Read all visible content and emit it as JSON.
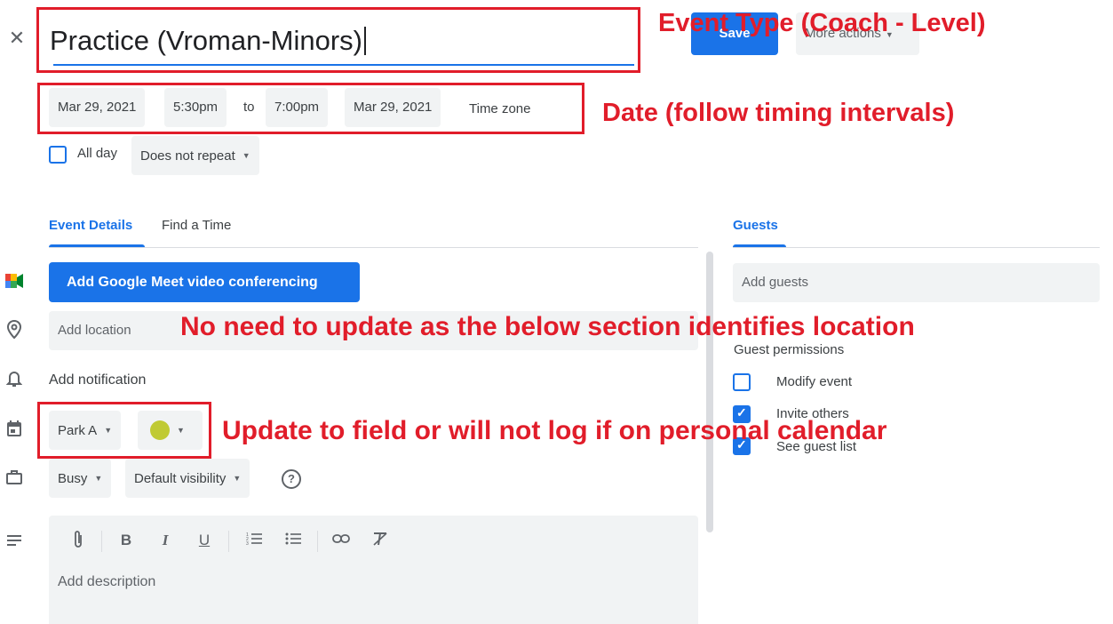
{
  "header": {
    "close_icon": "close-icon",
    "title": "Practice (Vroman-Minors)",
    "save_label": "Save",
    "more_actions_label": "More actions"
  },
  "datetime": {
    "start_date": "Mar 29, 2021",
    "start_time": "5:30pm",
    "to_label": "to",
    "end_time": "7:00pm",
    "end_date": "Mar 29, 2021",
    "time_zone_label": "Time zone",
    "all_day_label": "All day",
    "all_day_checked": false,
    "repeat_value": "Does not repeat"
  },
  "tabs": [
    {
      "label": "Event Details",
      "active": true
    },
    {
      "label": "Find a Time",
      "active": false
    }
  ],
  "details": {
    "meet_button_label": "Add Google Meet video conferencing",
    "location_placeholder": "Add location",
    "notification_label": "Add notification",
    "calendar_value": "Park A",
    "event_color": "#c0ca33",
    "availability_value": "Busy",
    "visibility_value": "Default visibility",
    "description_placeholder": "Add description"
  },
  "guests": {
    "tab_label": "Guests",
    "input_placeholder": "Add guests",
    "permissions_title": "Guest permissions",
    "permissions": [
      {
        "label": "Modify event",
        "checked": false
      },
      {
        "label": "Invite others",
        "checked": true
      },
      {
        "label": "See guest list",
        "checked": true
      }
    ]
  },
  "annotations": {
    "event_type": "Event Type (Coach - Level)",
    "date": "Date (follow timing intervals)",
    "location": "No need to update as the below section identifies location",
    "field": "Update to field or will not log if on personal calendar"
  },
  "colors": {
    "primary": "#1a73e8",
    "annotation_red": "#e11d2a",
    "chip_bg": "#f1f3f4"
  }
}
